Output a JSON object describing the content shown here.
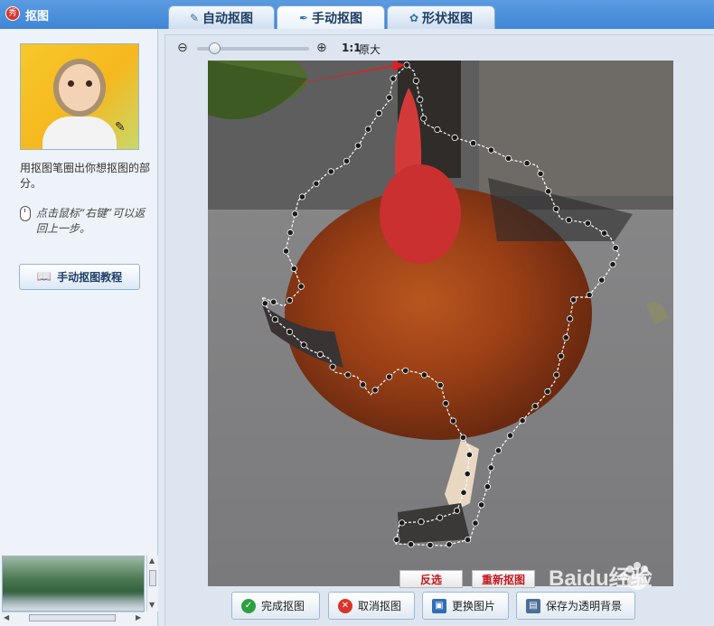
{
  "window": {
    "title": "抠图",
    "app_icon_glyph": "秀"
  },
  "tabs": [
    {
      "label": "自动抠图",
      "icon": "brush-icon",
      "active": false
    },
    {
      "label": "手动抠图",
      "icon": "pen-icon",
      "active": true
    },
    {
      "label": "形状抠图",
      "icon": "shape-icon",
      "active": false
    }
  ],
  "sidebar": {
    "hint1": "用抠图笔圈出你想抠图的部分。",
    "hint2": "点击鼠标“右键”可以返回上一步。",
    "tutorial_button": "手动抠图教程"
  },
  "zoom": {
    "level": 0.12,
    "ratio_strong": "1:1",
    "ratio_label": "原大"
  },
  "canvas_actions": {
    "invert": "反选",
    "redo": "重新抠图"
  },
  "bottom_buttons": {
    "finish": "完成抠图",
    "cancel": "取消抠图",
    "replace": "更换图片",
    "save_transparent": "保存为透明背景"
  },
  "watermark": "Baidu经验",
  "colors": {
    "titlebar": "#3f86d6",
    "accent_red": "#c3181f",
    "finish_green": "#2ea043",
    "cancel_red": "#d9342b"
  }
}
